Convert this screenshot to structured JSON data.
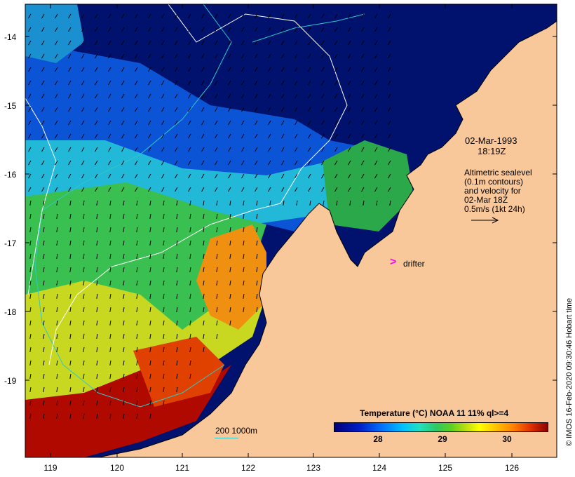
{
  "map": {
    "lat_ticks": [
      "-14",
      "-15",
      "-16",
      "-17",
      "-18",
      "-19"
    ],
    "lon_ticks": [
      "119",
      "120",
      "121",
      "122",
      "123",
      "124",
      "125",
      "126"
    ],
    "datetime_line1": "02-Mar-1993",
    "datetime_line2": "18:19Z",
    "altimetry_lines": [
      "Altimetric sealevel",
      "(0.1m contours)",
      "and velocity for",
      "02-Mar 18Z",
      "0.5m/s (1kt 24h)"
    ],
    "drifter_symbol": ">",
    "drifter_label": "drifter",
    "contour_legend": "200  1000m",
    "colorbar_title": "Temperature (°C) NOAA 11 11% ql>=4",
    "colorbar_ticks": [
      "28",
      "29",
      "30"
    ],
    "credit": "© IMOS 16-Feb-2020 09:30:46 Hobart time"
  },
  "colors": {
    "land": "#f9c89a",
    "deep_sea": "#00106c",
    "contour": "#ffffff",
    "bathy": "#30c8c8",
    "drifter": "#ff00ff"
  }
}
